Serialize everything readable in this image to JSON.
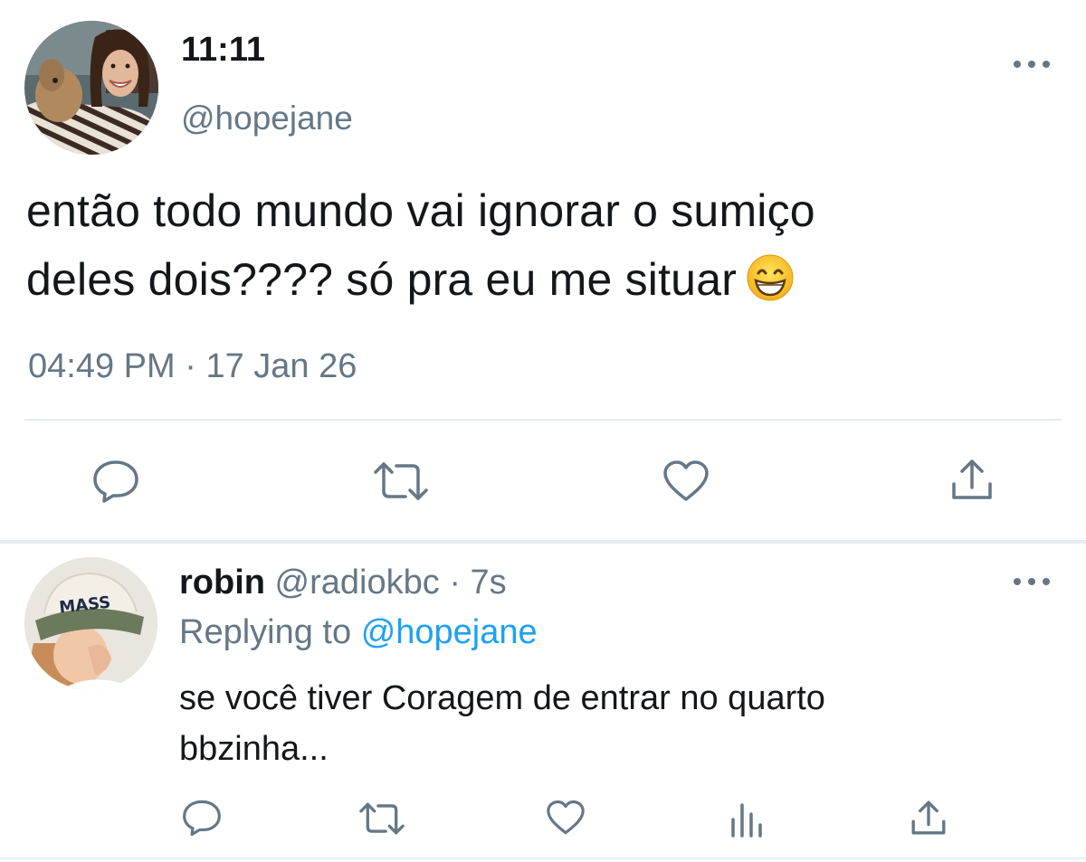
{
  "main_tweet": {
    "display_name": "11:11",
    "handle": "@hopejane",
    "text_line1": "então todo mundo vai ignorar o sumiço",
    "text_line2": "deles dois???? só pra eu me situar",
    "emoji": "grinning-face-with-smiling-eyes",
    "time": "04:49 PM",
    "separator": "·",
    "date": "17 Jan 26",
    "actions": [
      "reply-icon",
      "retweet-icon",
      "like-icon",
      "share-icon"
    ]
  },
  "reply_tweet": {
    "display_name": "robin",
    "handle": "@radiokbc",
    "separator": "·",
    "age": "7s",
    "replying_prefix": "Replying to",
    "replying_mention": "@hopejane",
    "text_line1": "se você tiver Coragem de entrar no quarto",
    "text_line2": "bbzinha...",
    "hat_text": "MASS",
    "actions": [
      "reply-icon",
      "retweet-icon",
      "like-icon",
      "analytics-icon",
      "share-icon"
    ]
  },
  "colors": {
    "text": "#14171a",
    "secondary": "#657786",
    "link": "#1da1f2",
    "divider": "#e6ecf0"
  }
}
